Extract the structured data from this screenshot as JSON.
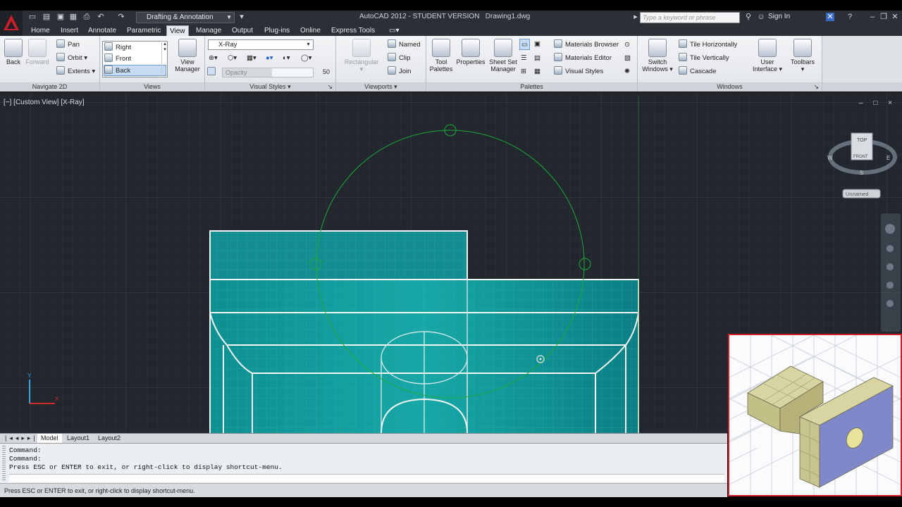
{
  "app": {
    "title": "AutoCAD 2012 - STUDENT VERSION",
    "drawing": "Drawing1.dwg",
    "workspace": "Drafting & Annotation",
    "search_placeholder": "Type a keyword or phrase",
    "sign_in": "Sign In"
  },
  "ribbon_tabs": [
    "Home",
    "Insert",
    "Annotate",
    "Parametric",
    "View",
    "Manage",
    "Output",
    "Plug-ins",
    "Online",
    "Express Tools"
  ],
  "active_tab": "View",
  "panels": {
    "navigate": {
      "title": "Navigate 2D",
      "back": "Back",
      "forward": "Forward",
      "pan": "Pan",
      "orbit": "Orbit",
      "extents": "Extents"
    },
    "views": {
      "title": "Views",
      "items": [
        "Right",
        "Front",
        "Back"
      ],
      "selected": "Back",
      "view_manager_line1": "View",
      "view_manager_line2": "Manager"
    },
    "visual_styles": {
      "title": "Visual Styles",
      "current": "X-Ray",
      "opacity_label": "Opacity",
      "opacity_value": "50"
    },
    "viewports": {
      "title": "Viewports",
      "rectangular": "Rectangular",
      "named": "Named",
      "clip": "Clip",
      "join": "Join"
    },
    "palettes": {
      "title": "Palettes",
      "tool_palettes_1": "Tool",
      "tool_palettes_2": "Palettes",
      "properties": "Properties",
      "ssm_1": "Sheet Set",
      "ssm_2": "Manager",
      "materials_browser": "Materials Browser",
      "materials_editor": "Materials Editor",
      "visual_styles": "Visual Styles"
    },
    "windows": {
      "title": "Windows",
      "switch_1": "Switch",
      "switch_2": "Windows",
      "tile_h": "Tile Horizontally",
      "tile_v": "Tile Vertically",
      "cascade": "Cascade",
      "ui_1": "User",
      "ui_2": "Interface",
      "toolbars": "Toolbars"
    }
  },
  "viewport": {
    "label": "[−] [Custom View] [X-Ray]",
    "window_controls": "– □ ×",
    "viewcube_top": "TOP",
    "viewcube_front": "FRONT",
    "compass_w": "W",
    "compass_e": "E",
    "compass_s": "S",
    "ucs_label": "Unnamed"
  },
  "layout_tabs": [
    "Model",
    "Layout1",
    "Layout2"
  ],
  "active_layout": "Model",
  "command": {
    "lines": [
      "Command:",
      "Command:",
      "Press ESC or ENTER to exit, or right-click to display shortcut-menu."
    ]
  },
  "status": {
    "text": "Press ESC or ENTER to exit, or right-click to display shortcut-menu."
  },
  "colors": {
    "accent_red": "#d01e2a",
    "viewport_bg": "#22272e",
    "solid_teal": "#1aa6a6",
    "orbit_green": "#1fa83a",
    "preview_tan": "#c7c48f",
    "preview_blue": "#7f88c9"
  }
}
